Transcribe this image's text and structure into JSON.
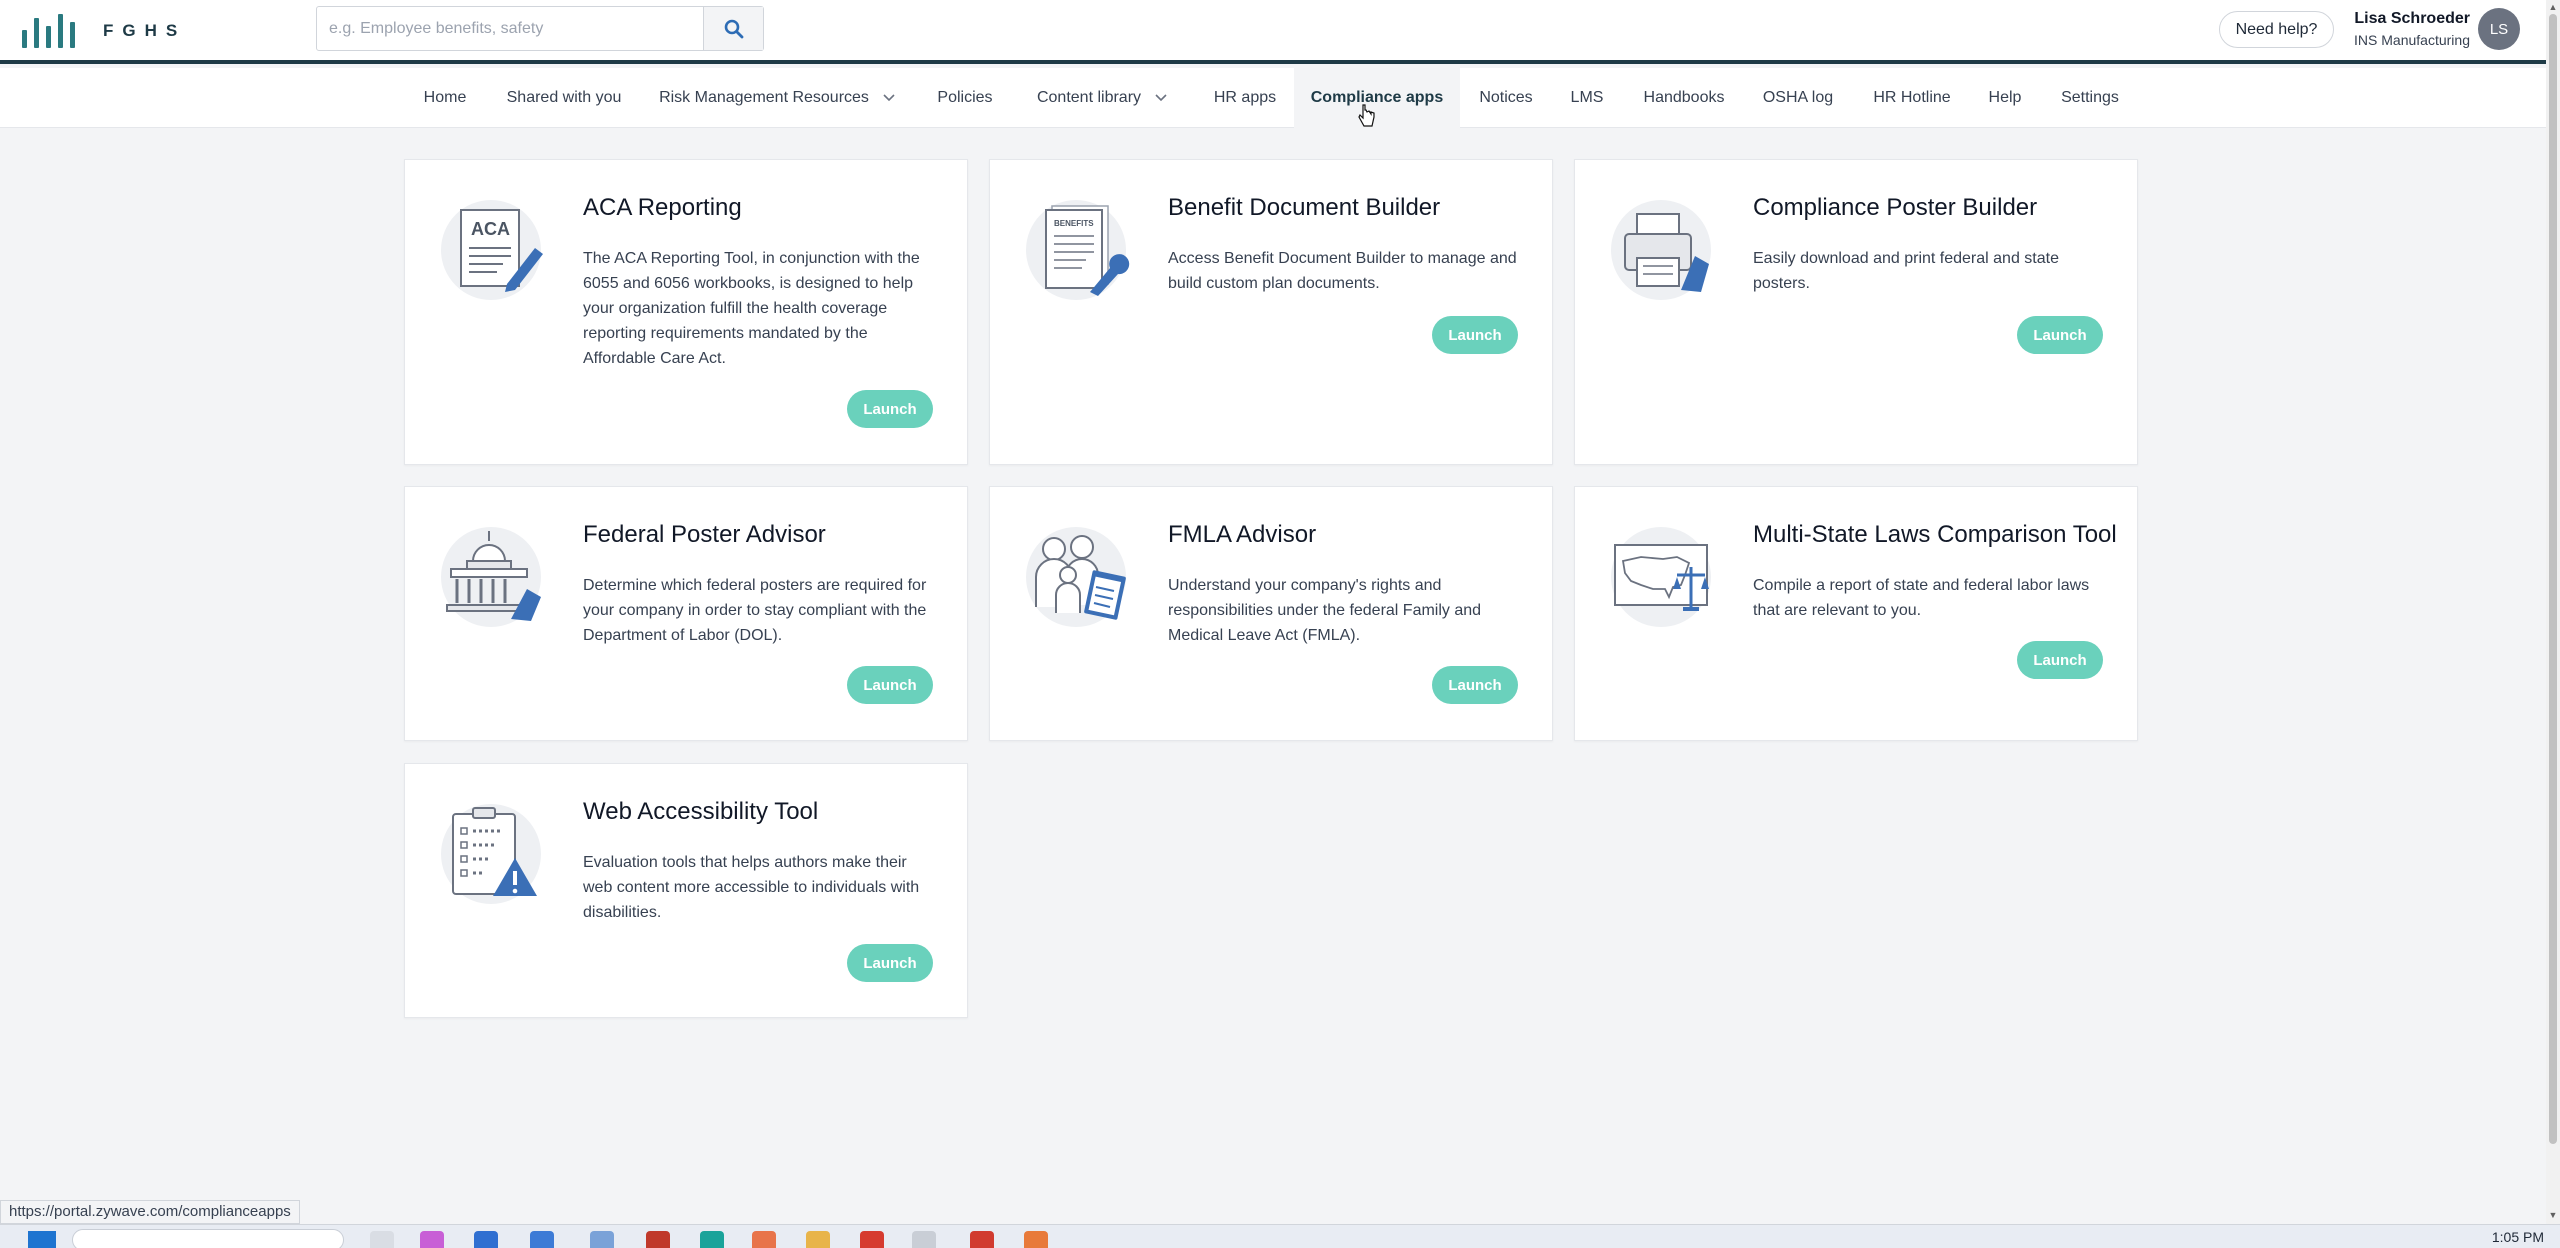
{
  "header": {
    "logo_text": "FGHS",
    "search_placeholder": "e.g. Employee benefits, safety",
    "search_icon": "search-icon",
    "help_label": "Need help?",
    "user_name": "Lisa Schroeder",
    "user_org": "INS Manufacturing",
    "avatar_initials": "LS"
  },
  "nav": {
    "items": [
      {
        "label": "Home"
      },
      {
        "label": "Shared with you"
      },
      {
        "label": "Risk Management Resources",
        "dropdown": true
      },
      {
        "label": "Policies"
      },
      {
        "label": "Content library",
        "dropdown": true
      },
      {
        "label": "HR apps"
      },
      {
        "label": "Compliance apps",
        "active": true
      },
      {
        "label": "Notices"
      },
      {
        "label": "LMS"
      },
      {
        "label": "Handbooks"
      },
      {
        "label": "OSHA log"
      },
      {
        "label": "HR Hotline"
      },
      {
        "label": "Help"
      },
      {
        "label": "Settings"
      }
    ]
  },
  "cards": [
    {
      "title": "ACA Reporting",
      "description": "The ACA Reporting Tool, in conjunction with the 6055 and 6056 workbooks, is designed to help your organization fulfill the health coverage reporting requirements mandated by the Affordable Care Act.",
      "launch_label": "Launch",
      "icon": "aca-document-icon",
      "icon_text": "ACA"
    },
    {
      "title": "Benefit Document Builder",
      "description": "Access Benefit Document Builder to manage and build custom plan documents.",
      "launch_label": "Launch",
      "icon": "benefits-document-wrench-icon",
      "icon_text": "BENEFITS"
    },
    {
      "title": "Compliance Poster Builder",
      "description": "Easily download and print federal and state posters.",
      "launch_label": "Launch",
      "icon": "printer-icon"
    },
    {
      "title": "Federal Poster Advisor",
      "description": "Determine which federal posters are required for your company in order to stay compliant with the Department of Labor (DOL).",
      "launch_label": "Launch",
      "icon": "capitol-building-icon"
    },
    {
      "title": "FMLA Advisor",
      "description": "Understand your company's rights and responsibilities under the federal Family and Medical Leave Act (FMLA).",
      "launch_label": "Launch",
      "icon": "family-clipboard-icon"
    },
    {
      "title": "Multi-State Laws Comparison Tool",
      "description": "Compile a report of state and federal labor laws that are relevant to you.",
      "launch_label": "Launch",
      "icon": "us-map-scales-icon"
    },
    {
      "title": "Web Accessibility Tool",
      "description": "Evaluation tools that helps authors make their web content more accessible to individuals with disabilities.",
      "launch_label": "Launch",
      "icon": "checklist-warning-icon"
    }
  ],
  "status_url": "https://portal.zywave.com/complianceapps",
  "taskbar": {
    "clock": "1:05 PM"
  },
  "colors": {
    "accent": "#6ad1bc",
    "brand": "#1e3a46",
    "logo": "#2a7a80",
    "icon_blue": "#3b6fb6"
  }
}
